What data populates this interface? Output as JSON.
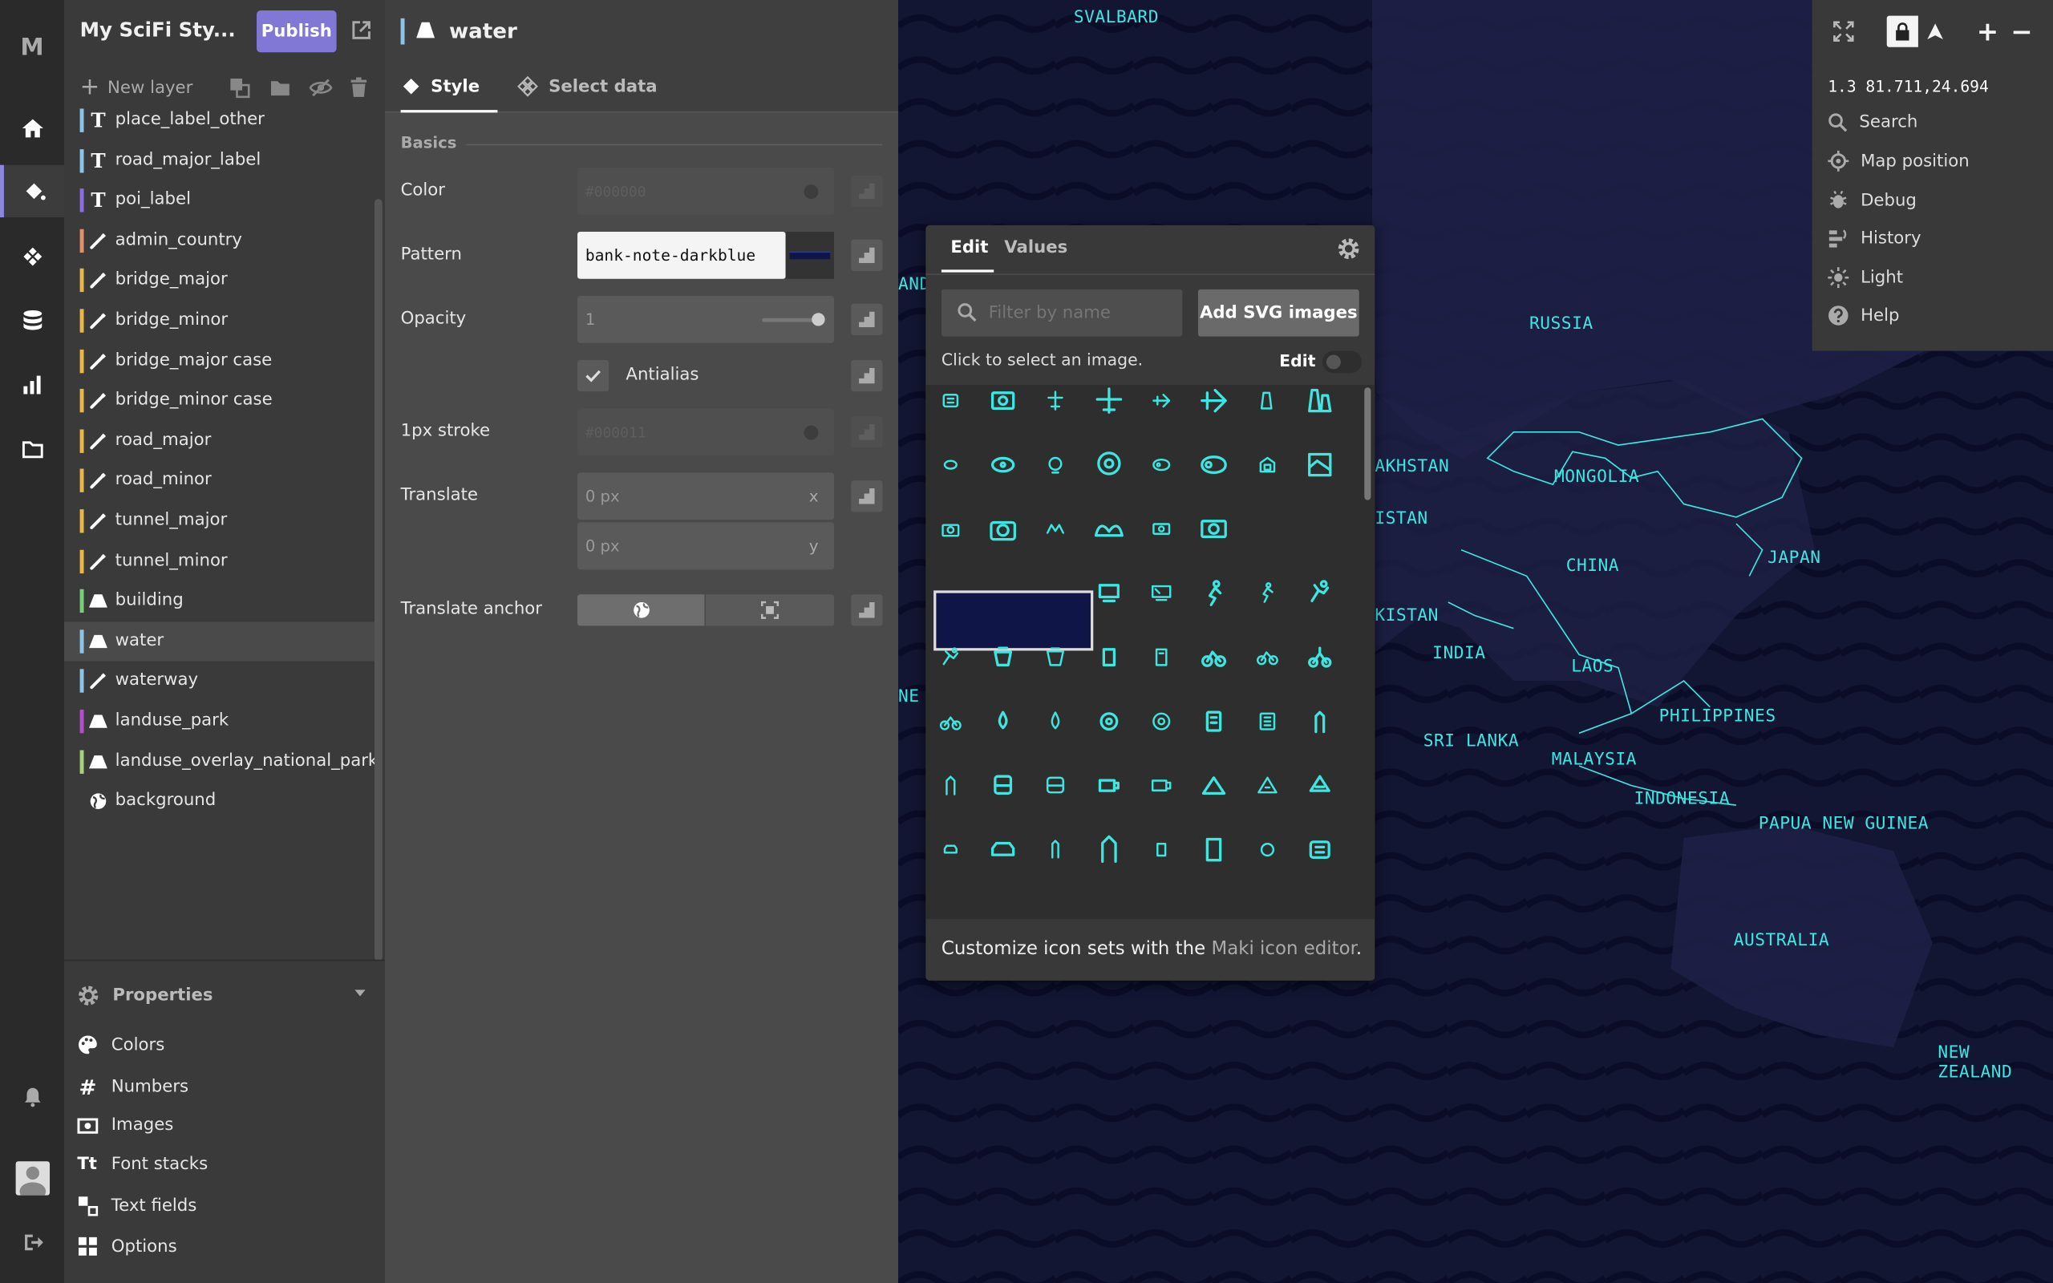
{
  "rail": {
    "logo": "M"
  },
  "layers_panel": {
    "style_title": "My SciFi Sty...",
    "publish_label": "Publish",
    "new_layer_label": "New layer",
    "layers": [
      {
        "name": "place_label_other",
        "type": "text-icon",
        "color": "#8ec3e6"
      },
      {
        "name": "road_major_label",
        "type": "text-icon",
        "color": "#8ec3e6"
      },
      {
        "name": "poi_label",
        "type": "text-icon",
        "color": "#8a6ee0"
      },
      {
        "name": "admin_country",
        "type": "line-icon",
        "color": "#e0906a"
      },
      {
        "name": "bridge_major",
        "type": "line-icon",
        "color": "#e6b84a"
      },
      {
        "name": "bridge_minor",
        "type": "line-icon",
        "color": "#e6b84a"
      },
      {
        "name": "bridge_major case",
        "type": "line-icon",
        "color": "#e6b84a"
      },
      {
        "name": "bridge_minor case",
        "type": "line-icon",
        "color": "#e6b84a"
      },
      {
        "name": "road_major",
        "type": "line-icon",
        "color": "#e6b84a"
      },
      {
        "name": "road_minor",
        "type": "line-icon",
        "color": "#e6b84a"
      },
      {
        "name": "tunnel_major",
        "type": "line-icon",
        "color": "#e6b84a"
      },
      {
        "name": "tunnel_minor",
        "type": "line-icon",
        "color": "#e6b84a"
      },
      {
        "name": "building",
        "type": "fill-icon",
        "color": "#7bcf7b"
      },
      {
        "name": "water",
        "type": "fill-icon",
        "color": "#8ec3e6"
      },
      {
        "name": "waterway",
        "type": "line-icon",
        "color": "#8ec3e6"
      },
      {
        "name": "landuse_park",
        "type": "fill-icon",
        "color": "#b04fc9"
      },
      {
        "name": "landuse_overlay_national_park",
        "type": "fill-icon",
        "color": "#a8d080"
      },
      {
        "name": "background",
        "type": "globe-icon",
        "color": ""
      }
    ],
    "properties_label": "Properties",
    "properties": [
      "Colors",
      "Numbers",
      "Images",
      "Font stacks",
      "Text fields",
      "Options"
    ]
  },
  "style_panel": {
    "layer_name": "water",
    "tab_style": "Style",
    "tab_select": "Select data",
    "section": "Basics",
    "color_label": "Color",
    "color_value": "#000000",
    "pattern_label": "Pattern",
    "pattern_value": "bank-note-darkblue",
    "opacity_label": "Opacity",
    "opacity_value": "1",
    "antialias_label": "Antialias",
    "stroke_label": "1px stroke",
    "stroke_value": "#000011",
    "translate_label": "Translate",
    "translate_x": "0 px",
    "translate_x_unit": "x",
    "translate_y": "0 px",
    "translate_y_unit": "y",
    "anchor_label": "Translate anchor"
  },
  "picker": {
    "tab_edit": "Edit",
    "tab_values": "Values",
    "filter_placeholder": "Filter by name",
    "add_svg": "Add SVG images",
    "hint": "Click to select an image.",
    "edit_toggle_label": "Edit",
    "footer_prefix": "Customize icon sets with the ",
    "footer_link": "Maki icon editor",
    "footer_suffix": "."
  },
  "map_controls": {
    "zoom_coords": "1.3 81.711,24.694",
    "items": [
      "Search",
      "Map position",
      "Debug",
      "History",
      "Light",
      "Help"
    ]
  },
  "map_labels": [
    "SVALBARD",
    "RUSSIA",
    "MONGOLIA",
    "CHINA",
    "JAPAN",
    "INDIA",
    "LAOS",
    "PHILIPPINES",
    "SRI LANKA",
    "MALAYSIA",
    "INDONESIA",
    "PAPUA NEW GUINEA",
    "AUSTRALIA",
    "NEW ZEALAND",
    "AKHSTAN",
    "ISTAN",
    "KISTAN",
    "AND",
    "NE"
  ],
  "colors": {
    "accent": "#8177d5",
    "map_bg": "#131633",
    "map_label": "#3de6e0"
  }
}
